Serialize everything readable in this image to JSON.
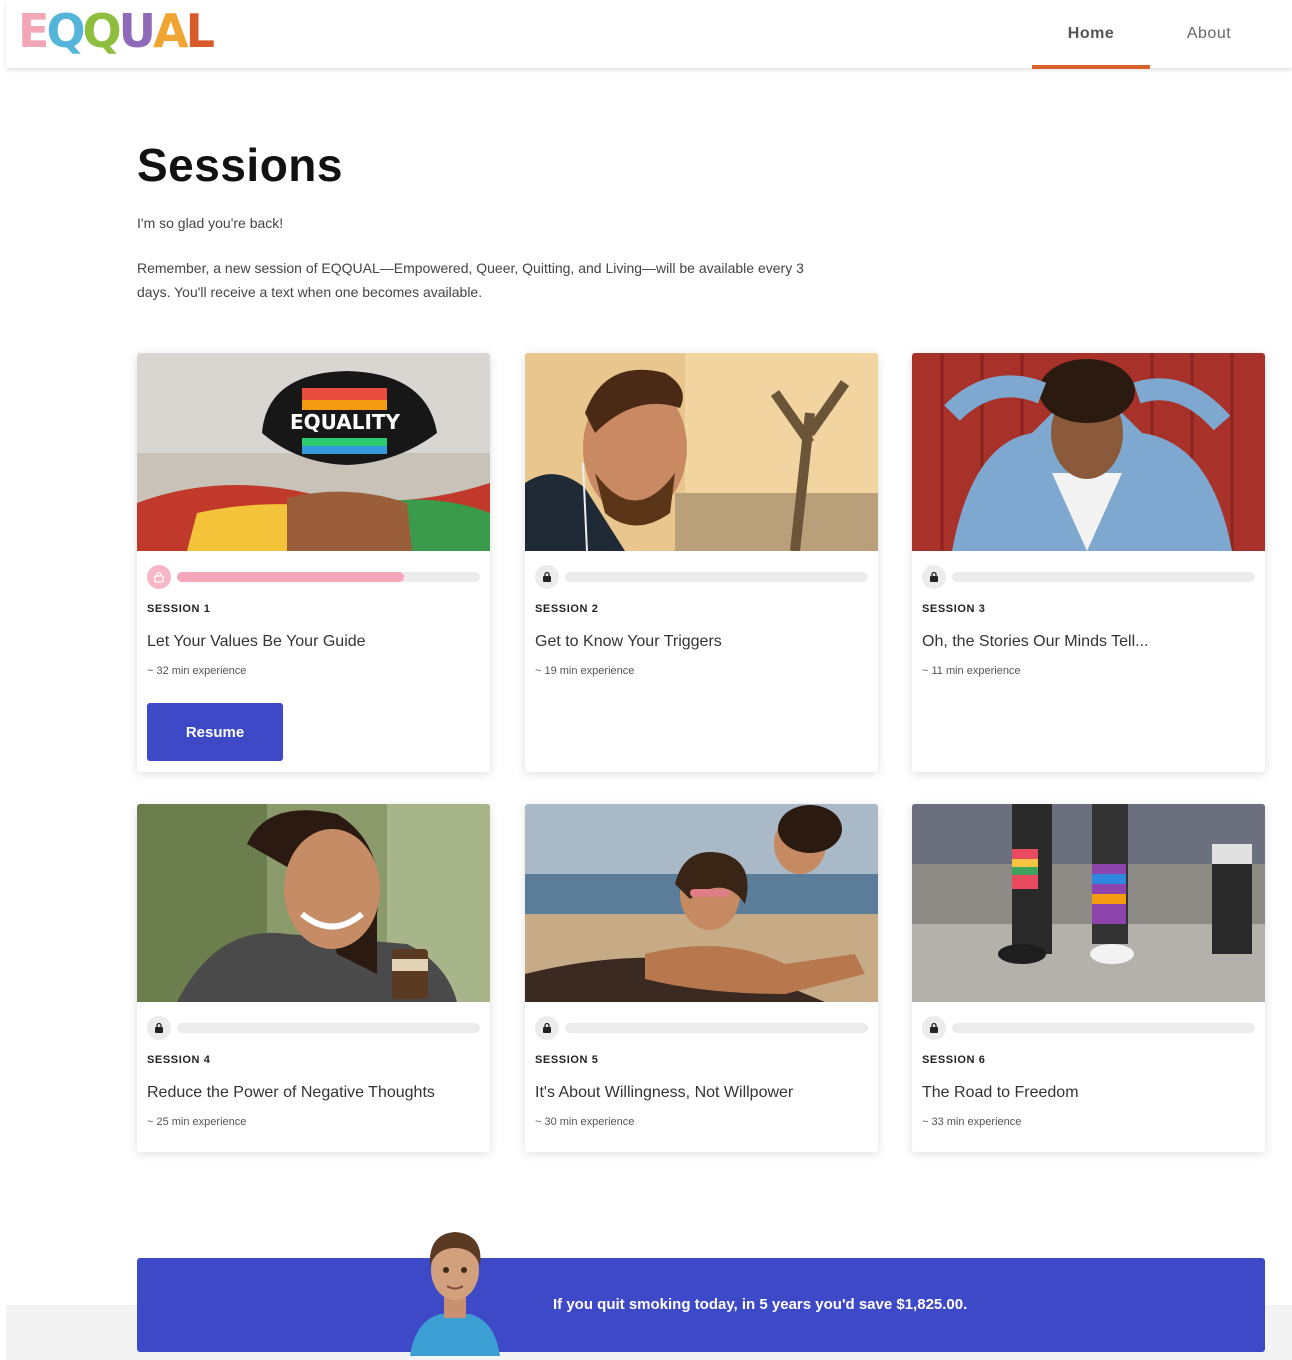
{
  "brand": {
    "letters": [
      "E",
      "Q",
      "Q",
      "U",
      "A",
      "L"
    ],
    "letter_colors": [
      "#f2a6b6",
      "#55b4d9",
      "#8fbe3e",
      "#8e6ab8",
      "#f0a431",
      "#d95a2b"
    ]
  },
  "nav": {
    "home": "Home",
    "about": "About",
    "active_color": "#d9622b"
  },
  "page": {
    "title": "Sessions",
    "greeting": "I'm so glad you're back!",
    "description": "Remember, a new session of EQQUAL—Empowered, Queer, Quitting, and Living—will be available every 3 days. You'll receive a text when one becomes available."
  },
  "sessions": [
    {
      "label": "SESSION 1",
      "title": "Let Your Values Be Your Guide",
      "duration": "~ 32 min experience",
      "progress": 0.75,
      "locked": false,
      "image": "photo-equality-cap",
      "action": "Resume"
    },
    {
      "label": "SESSION 2",
      "title": "Get to Know Your Triggers",
      "duration": "~ 19 min experience",
      "progress": 0,
      "locked": true,
      "image": "photo-man-earbuds"
    },
    {
      "label": "SESSION 3",
      "title": "Oh, the Stories Our Minds Tell...",
      "duration": "~ 11 min experience",
      "progress": 0,
      "locked": true,
      "image": "photo-woman-red-wall"
    },
    {
      "label": "SESSION 4",
      "title": "Reduce the Power of Negative Thoughts",
      "duration": "~ 25 min experience",
      "progress": 0,
      "locked": true,
      "image": "photo-smiling-coffee"
    },
    {
      "label": "SESSION 5",
      "title": "It's About Willingness, Not Willpower",
      "duration": "~ 30 min experience",
      "progress": 0,
      "locked": true,
      "image": "photo-beach-couple"
    },
    {
      "label": "SESSION 6",
      "title": "The Road to Freedom",
      "duration": "~ 33 min experience",
      "progress": 0,
      "locked": true,
      "image": "photo-rainbow-socks"
    }
  ],
  "icons": {
    "lock": "lock-icon",
    "unlock": "unlock-icon"
  },
  "banner": {
    "text": "If you quit smoking today, in 5 years you'd save $1,825.00.",
    "color": "#3d49c7"
  },
  "accent": "#3d49c7"
}
